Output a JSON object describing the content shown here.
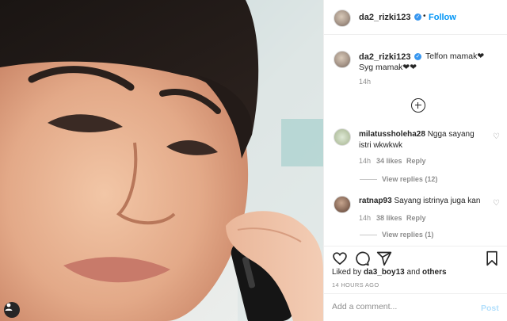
{
  "post": {
    "author": "da2_rizki123",
    "follow_label": "Follow",
    "dot": "•",
    "caption": {
      "username": "da2_rizki123",
      "line1": "Telfon mamak❤",
      "line2": "Syg mamak❤❤",
      "time": "14h"
    },
    "comments": [
      {
        "username": "milatussholeha28",
        "text": "Ngga sayang istri wkwkwk",
        "time": "14h",
        "likes": "34 likes",
        "reply_label": "Reply",
        "view_replies": "View replies (12)"
      },
      {
        "username": "ratnap93",
        "text": "Sayang istrinya juga kan",
        "time": "14h",
        "likes": "38 likes",
        "reply_label": "Reply",
        "view_replies": "View replies (1)"
      }
    ],
    "liked_by": {
      "prefix": "Liked by",
      "user": "da3_boy13",
      "conj": "and",
      "others": "others"
    },
    "timestamp": "14 HOURS AGO",
    "add_comment_placeholder": "Add a comment...",
    "post_label": "Post",
    "icons": [
      "heart-icon",
      "comment-icon",
      "share-icon",
      "bookmark-icon",
      "add-circle-icon",
      "user-tag-icon"
    ],
    "colors": {
      "accent": "#0095f6",
      "verified": "#3897f0",
      "muted": "#8e8e8e"
    }
  }
}
